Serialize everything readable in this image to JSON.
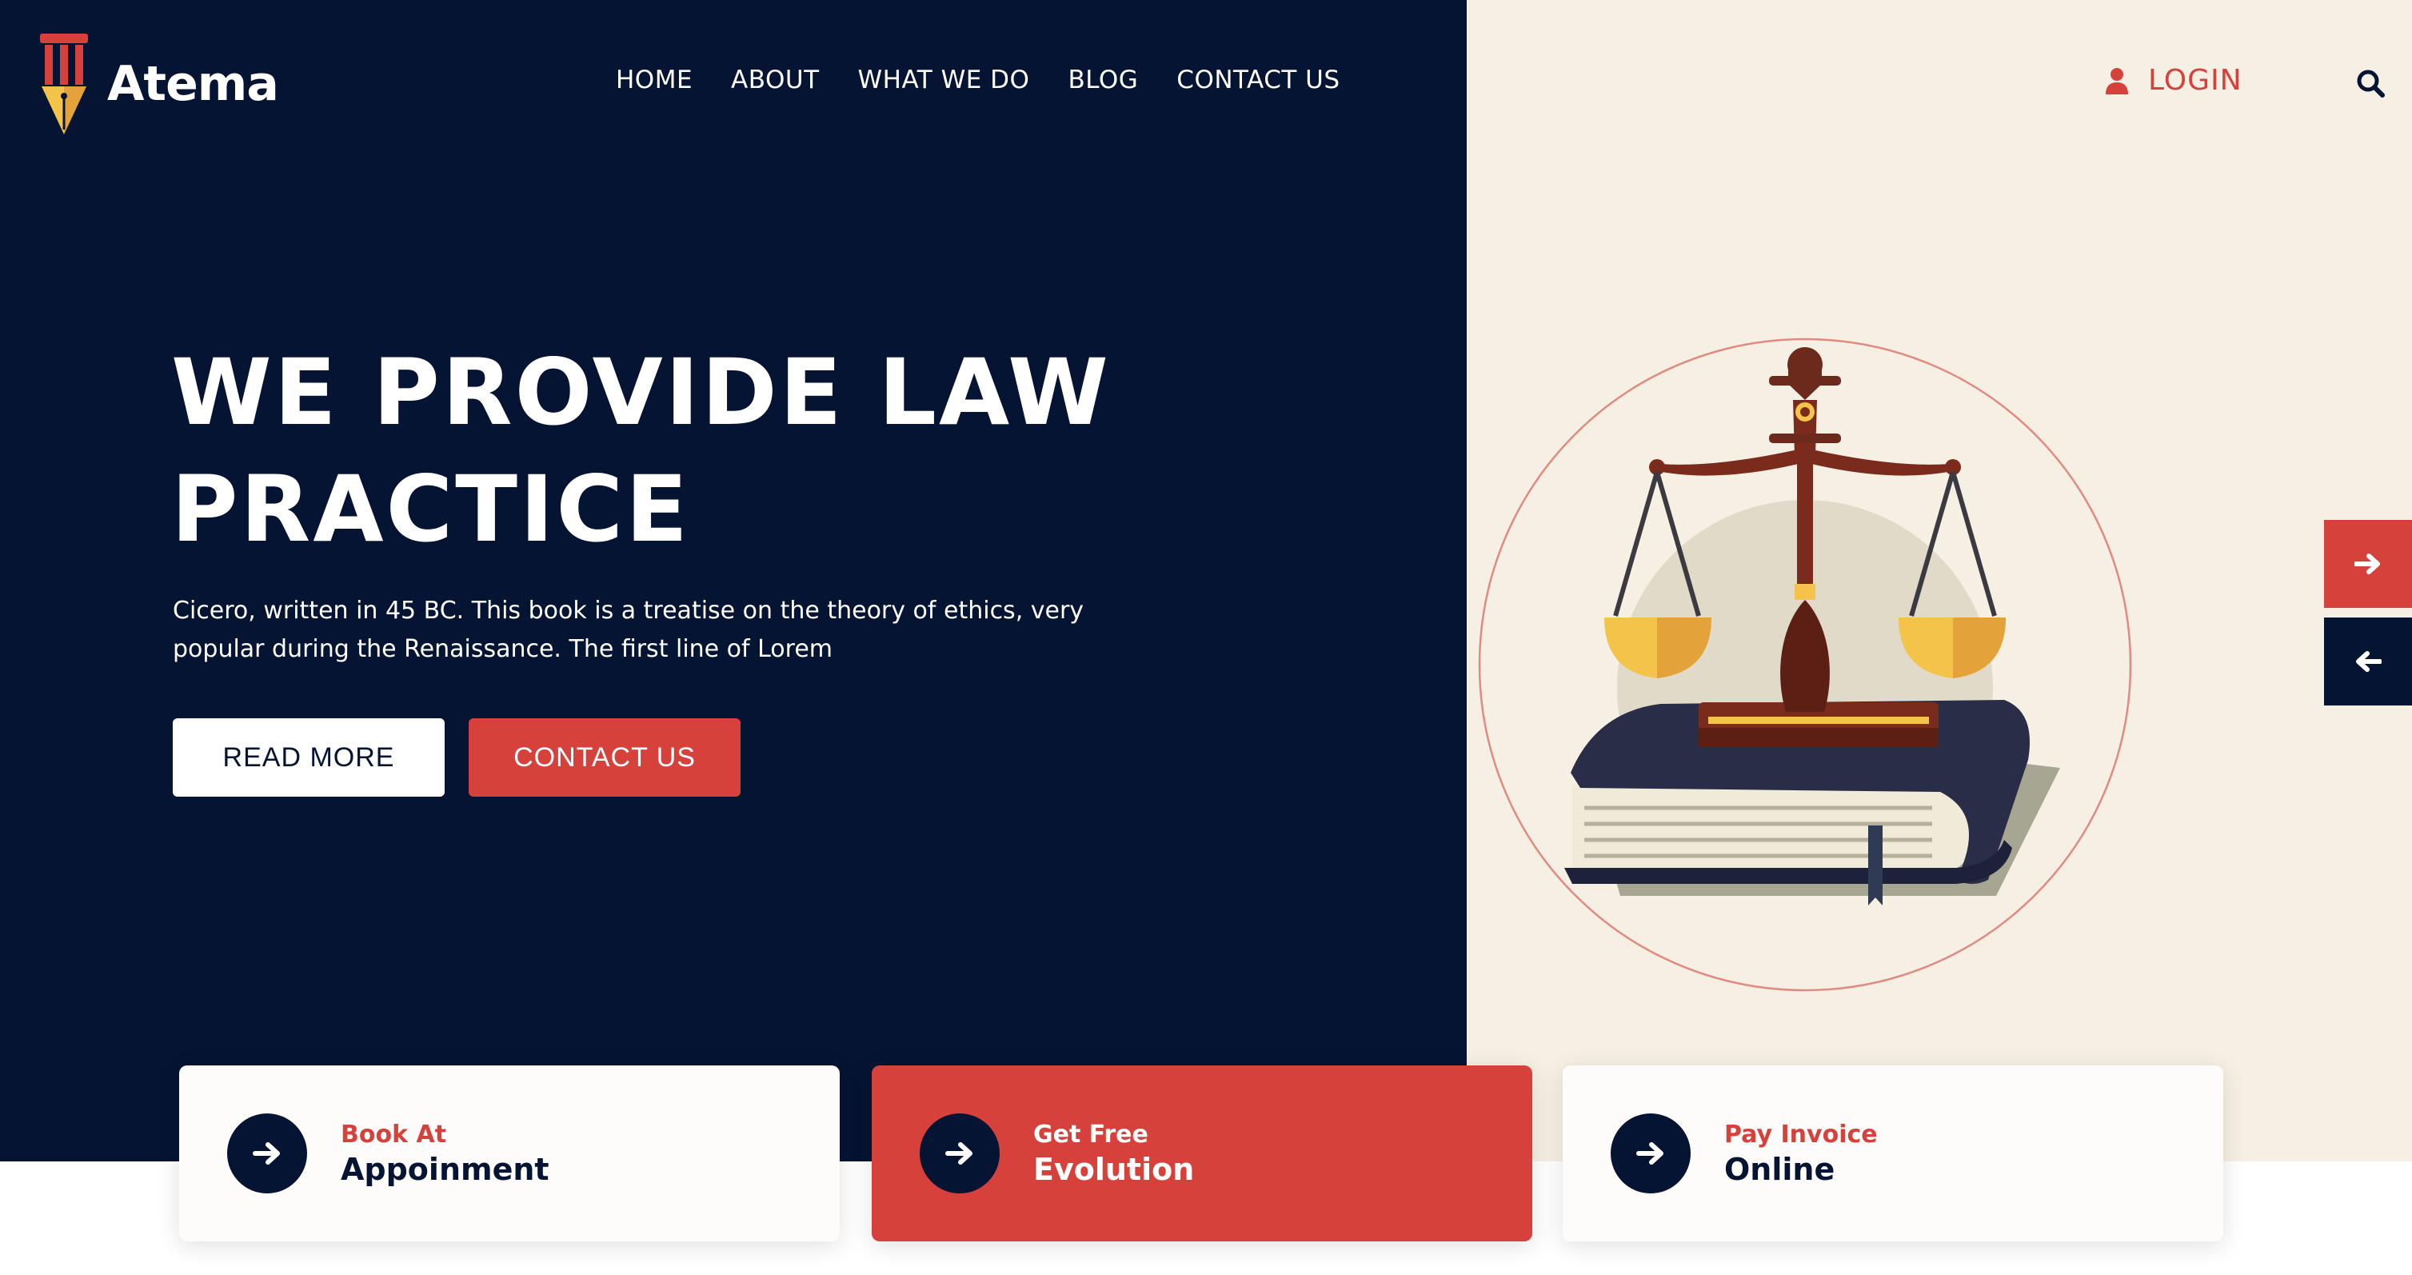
{
  "brand": {
    "name": "Atema"
  },
  "nav": {
    "items": [
      "HOME",
      "ABOUT",
      "WHAT WE DO",
      "BLOG",
      "CONTACT US"
    ]
  },
  "header": {
    "login_label": "LOGIN",
    "login_icon": "user-icon",
    "search_icon": "search-icon"
  },
  "hero": {
    "title_line1": "WE PROVIDE LAW",
    "title_line2": "PRACTICE",
    "description_line1": "Cicero, written in 45 BC. This book is a treatise on the theory of ethics, very",
    "description_line2": "popular during the Renaissance. The first line of Lorem",
    "read_more_label": "READ MORE",
    "contact_label": "CONTACT US"
  },
  "slider": {
    "next_icon": "arrow-right-icon",
    "prev_icon": "arrow-left-icon"
  },
  "cards": [
    {
      "small": "Book At",
      "big": "Appoinment",
      "icon": "arrow-right-icon"
    },
    {
      "small": "Get Free",
      "big": "Evolution",
      "icon": "arrow-right-icon"
    },
    {
      "small": "Pay Invoice",
      "big": "Online",
      "icon": "arrow-right-icon"
    }
  ],
  "colors": {
    "navy": "#061433",
    "accent": "#d6413b",
    "cream": "#f6f0e4",
    "white": "#ffffff"
  }
}
